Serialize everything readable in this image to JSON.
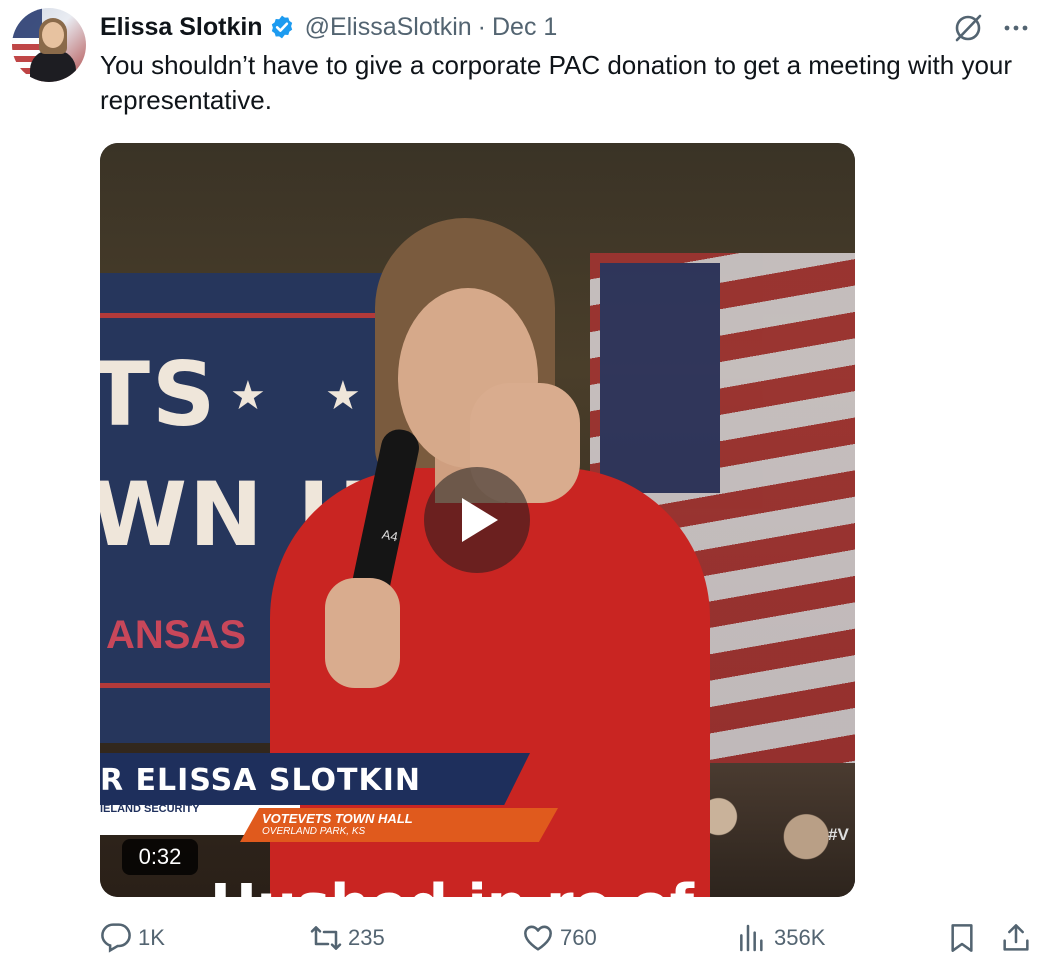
{
  "tweet": {
    "author_name": "Elissa Slotkin",
    "handle": "@ElissaSlotkin",
    "separator": "·",
    "date": "Dec 1",
    "text": "You shouldn’t have to give a corporate PAC donation to get a meeting with your representative."
  },
  "media": {
    "duration": "0:32",
    "banner_big_1": "TS",
    "banner_big_2": "WN H",
    "banner_sub": "ANSAS",
    "mic_label": "A4",
    "lower_third_name": "R ELISSA SLOTKIN",
    "lower_third_role": "IELAND SECURITY",
    "lower_third_event": "VOTEVETS TOWN HALL",
    "lower_third_location": "OVERLAND PARK, KS",
    "hashtag": "#V",
    "caption_fragment": "Hushed in re of th"
  },
  "actions": {
    "replies": "1K",
    "reposts": "235",
    "likes": "760",
    "views": "356K"
  },
  "icons": {
    "verified": "verified-badge-icon",
    "grok": "grok-icon",
    "more": "more-icon",
    "reply": "reply-icon",
    "repost": "repost-icon",
    "like": "heart-icon",
    "views": "views-icon",
    "bookmark": "bookmark-icon",
    "share": "share-icon",
    "play": "play-icon"
  },
  "colors": {
    "text": "#0f1419",
    "secondary": "#536471",
    "verified": "#1d9bf0"
  }
}
